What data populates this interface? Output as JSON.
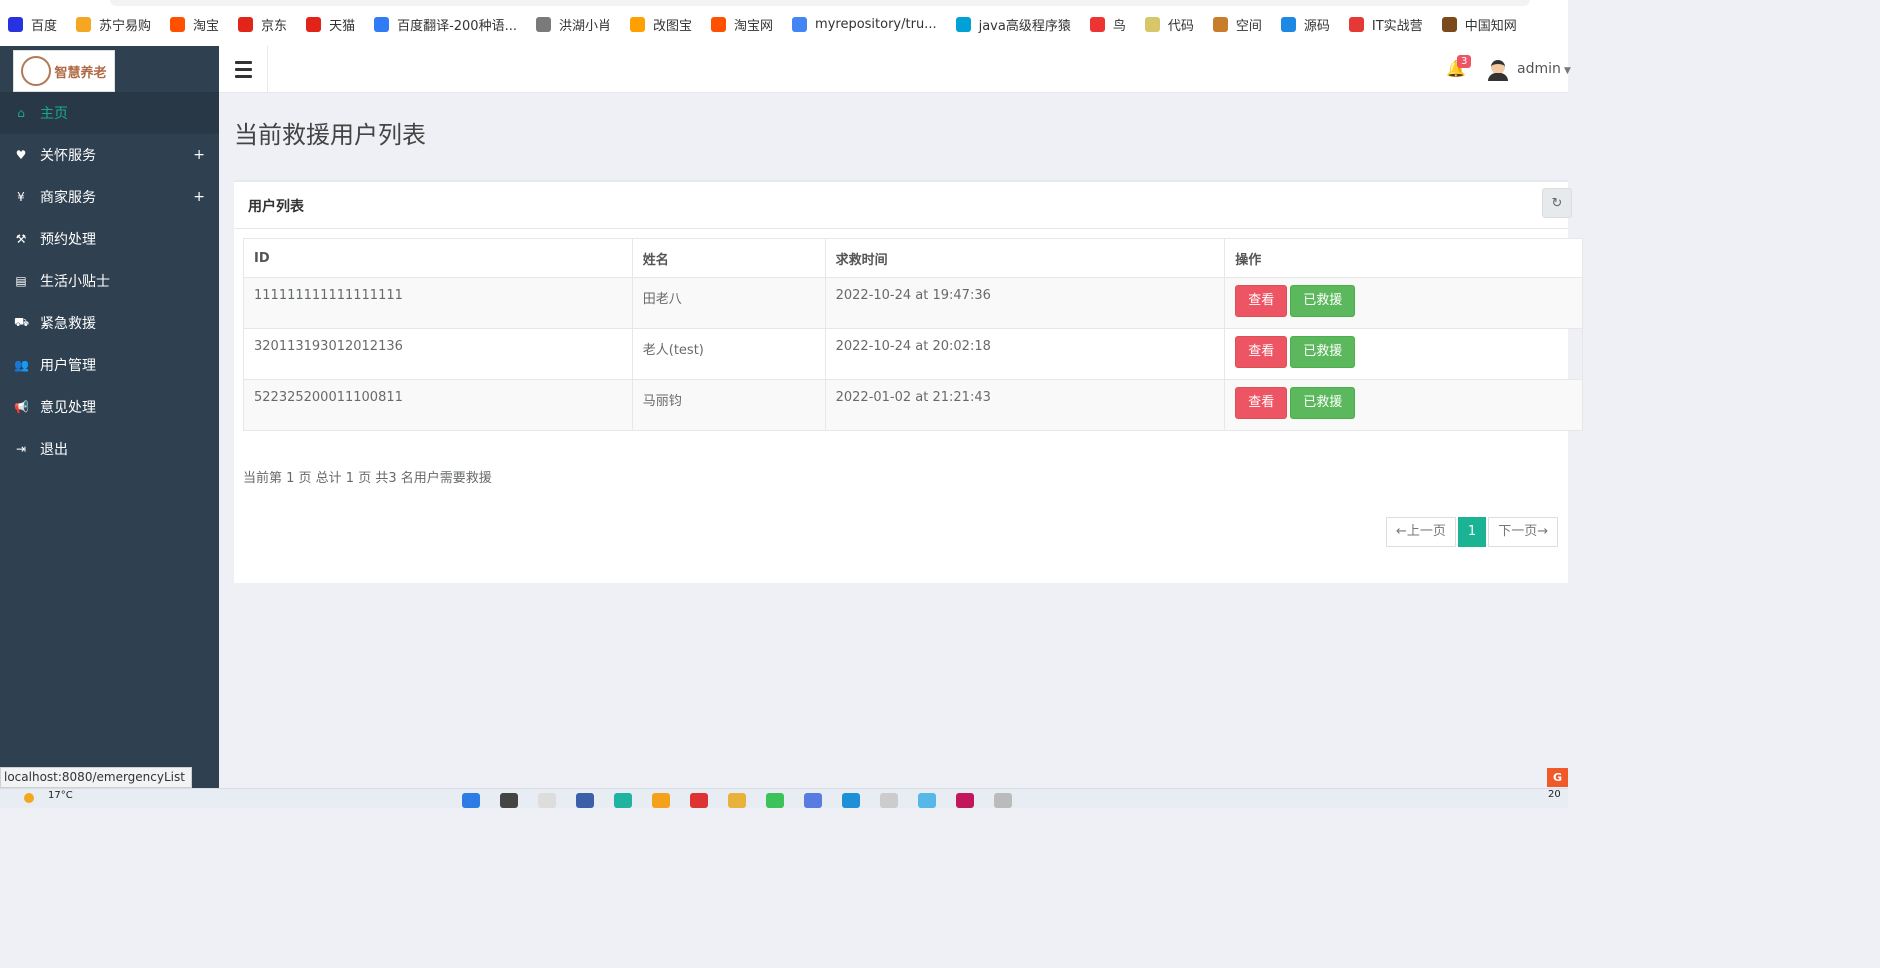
{
  "bookmarks": [
    {
      "label": "百度",
      "icon": "paw-icon",
      "color": "#2932e1"
    },
    {
      "label": "苏宁易购",
      "icon": "lion-icon",
      "color": "#f5a623"
    },
    {
      "label": "淘宝",
      "icon": "taobao-icon",
      "color": "#ff5000"
    },
    {
      "label": "京东",
      "icon": "jd-icon",
      "color": "#e1251b"
    },
    {
      "label": "天猫",
      "icon": "tmall-icon",
      "color": "#e2231a"
    },
    {
      "label": "百度翻译-200种语...",
      "icon": "translate-icon",
      "color": "#2f7cf6"
    },
    {
      "label": "洪湖小肖",
      "icon": "bird-icon",
      "color": "#7a7a7a"
    },
    {
      "label": "改图宝",
      "icon": "image-icon",
      "color": "#ff9f00"
    },
    {
      "label": "淘宝网",
      "icon": "taobao-icon",
      "color": "#ff5000"
    },
    {
      "label": "myrepository/tru...",
      "icon": "chrome-icon",
      "color": "#4285f4"
    },
    {
      "label": "java高级程序猿",
      "icon": "bilibili-icon",
      "color": "#00a1d6"
    },
    {
      "label": "鸟",
      "icon": "bird-icon",
      "color": "#e33"
    },
    {
      "label": "代码",
      "icon": "code-icon",
      "color": "#d8c76a"
    },
    {
      "label": "空间",
      "icon": "space-icon",
      "color": "#c77d2a"
    },
    {
      "label": "源码",
      "icon": "fish-icon",
      "color": "#1e88e5"
    },
    {
      "label": "IT实战营",
      "icon": "chrome-icon",
      "color": "#e53935"
    },
    {
      "label": "中国知网",
      "icon": "cnki-icon",
      "color": "#7a4a1b"
    }
  ],
  "logo": {
    "text": "智慧养老"
  },
  "nav": [
    {
      "label": "主页",
      "icon": "home-icon",
      "glyph": "⌂",
      "active": true,
      "expand": ""
    },
    {
      "label": "关怀服务",
      "icon": "heart-icon",
      "glyph": "♥",
      "active": false,
      "expand": "+"
    },
    {
      "label": "商家服务",
      "icon": "yen-icon",
      "glyph": "¥",
      "active": false,
      "expand": "+"
    },
    {
      "label": "预约处理",
      "icon": "gavel-icon",
      "glyph": "⚒",
      "active": false,
      "expand": ""
    },
    {
      "label": "生活小贴士",
      "icon": "book-icon",
      "glyph": "▤",
      "active": false,
      "expand": ""
    },
    {
      "label": "紧急救援",
      "icon": "ambulance-icon",
      "glyph": "⛟",
      "active": false,
      "expand": ""
    },
    {
      "label": "用户管理",
      "icon": "users-icon",
      "glyph": "👥",
      "active": false,
      "expand": ""
    },
    {
      "label": "意见处理",
      "icon": "bullhorn-icon",
      "glyph": "📢",
      "active": false,
      "expand": ""
    },
    {
      "label": "退出",
      "icon": "sign-in-icon",
      "glyph": "⇥",
      "active": false,
      "expand": ""
    }
  ],
  "header": {
    "notification_count": "3",
    "user": "admin"
  },
  "page": {
    "title": "当前救援用户列表"
  },
  "card": {
    "title": "用户列表"
  },
  "table": {
    "columns": [
      "ID",
      "姓名",
      "求救时间",
      "操作"
    ],
    "rows": [
      {
        "id": "111111111111111111",
        "name": "田老八",
        "time": "2022-10-24 at 19:47:36"
      },
      {
        "id": "320113193012012136",
        "name": "老人(test)",
        "time": "2022-10-24 at 20:02:18"
      },
      {
        "id": "522325200011100811",
        "name": "马丽钧",
        "time": "2022-01-02 at 21:21:43"
      }
    ],
    "view_label": "查看",
    "rescued_label": "已救援"
  },
  "summary": "当前第 1 页 总计 1 页 共3 名用户需要救援",
  "pagination": {
    "prev": "←上一页",
    "current": "1",
    "next": "下一页→"
  },
  "status_url": "localhost:8080/emergencyList",
  "taskbar": {
    "temperature": "17°C",
    "clock": "20"
  },
  "colors": {
    "sidebar": "#2f4050",
    "accent": "#1ab394",
    "danger": "#ed5565",
    "success": "#5cb85c"
  }
}
